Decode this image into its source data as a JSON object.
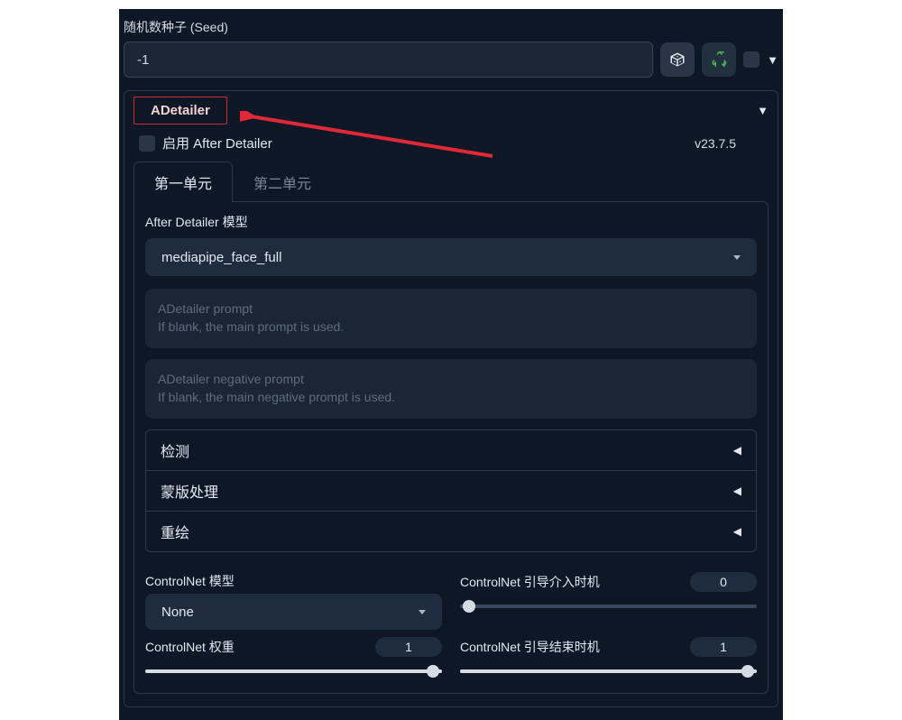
{
  "seed": {
    "label": "随机数种子 (Seed)",
    "value": "-1"
  },
  "panel": {
    "title": "ADetailer",
    "enable_label": "启用 After Detailer",
    "version": "v23.7.5"
  },
  "tabs": {
    "first": "第一单元",
    "second": "第二单元"
  },
  "model": {
    "label": "After Detailer 模型",
    "value": "mediapipe_face_full"
  },
  "prompts": {
    "positive_placeholder": "ADetailer prompt\nIf blank, the main prompt is used.",
    "negative_placeholder": "ADetailer negative prompt\nIf blank, the main negative prompt is used."
  },
  "accordion": {
    "detect": "检测",
    "mask": "蒙版处理",
    "inpaint": "重绘"
  },
  "controlnet": {
    "model_label": "ControlNet 模型",
    "model_value": "None",
    "weight_label": "ControlNet 权重",
    "weight_value": "1",
    "start_label": "ControlNet 引导介入时机",
    "start_value": "0",
    "end_label": "ControlNet 引导结束时机",
    "end_value": "1"
  }
}
